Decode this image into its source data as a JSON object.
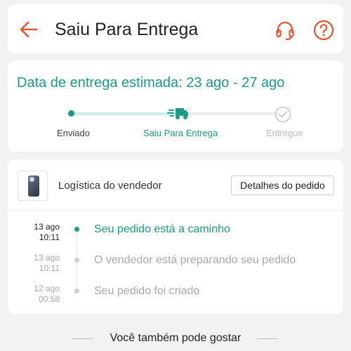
{
  "colors": {
    "accent_orange": "#e8552d",
    "accent_teal": "#1a9b86",
    "progress_light": "#cdeee8",
    "muted_text": "#aaaaaa",
    "background": "#f2f2f2"
  },
  "header": {
    "title": "Saiu Para Entrega",
    "back_icon": "arrow-left-icon",
    "support_icon": "headset-icon",
    "help_icon": "question-circle-icon"
  },
  "status": {
    "estimated_delivery": "Data de entrega estimada: 23 ago - 27 ago",
    "progress_fraction": 0.5,
    "steps": [
      {
        "label": "Enviado",
        "icon": "dot-icon",
        "state": "done"
      },
      {
        "label": "Saiu Para Entrega",
        "icon": "truck-icon",
        "state": "current"
      },
      {
        "label": "Entregue",
        "icon": "check-circle-icon",
        "state": "pending"
      }
    ]
  },
  "logistics": {
    "label": "Logística do vendedor",
    "details_button": "Detalhes do pedido",
    "product_icon": "phone-thumbnail-icon",
    "events": [
      {
        "date": "13 ago",
        "time": "10:11",
        "text": "Seu pedido está a caminho",
        "active": true
      },
      {
        "date": "13 ago",
        "time": "10:11",
        "text": "O vendedor está preparando seu pedido",
        "active": false
      },
      {
        "date": "12 ago",
        "time": "00:58",
        "text": "Seu pedido foi criado",
        "active": false
      }
    ]
  },
  "recommendations": {
    "title": "Você também pode gostar"
  }
}
